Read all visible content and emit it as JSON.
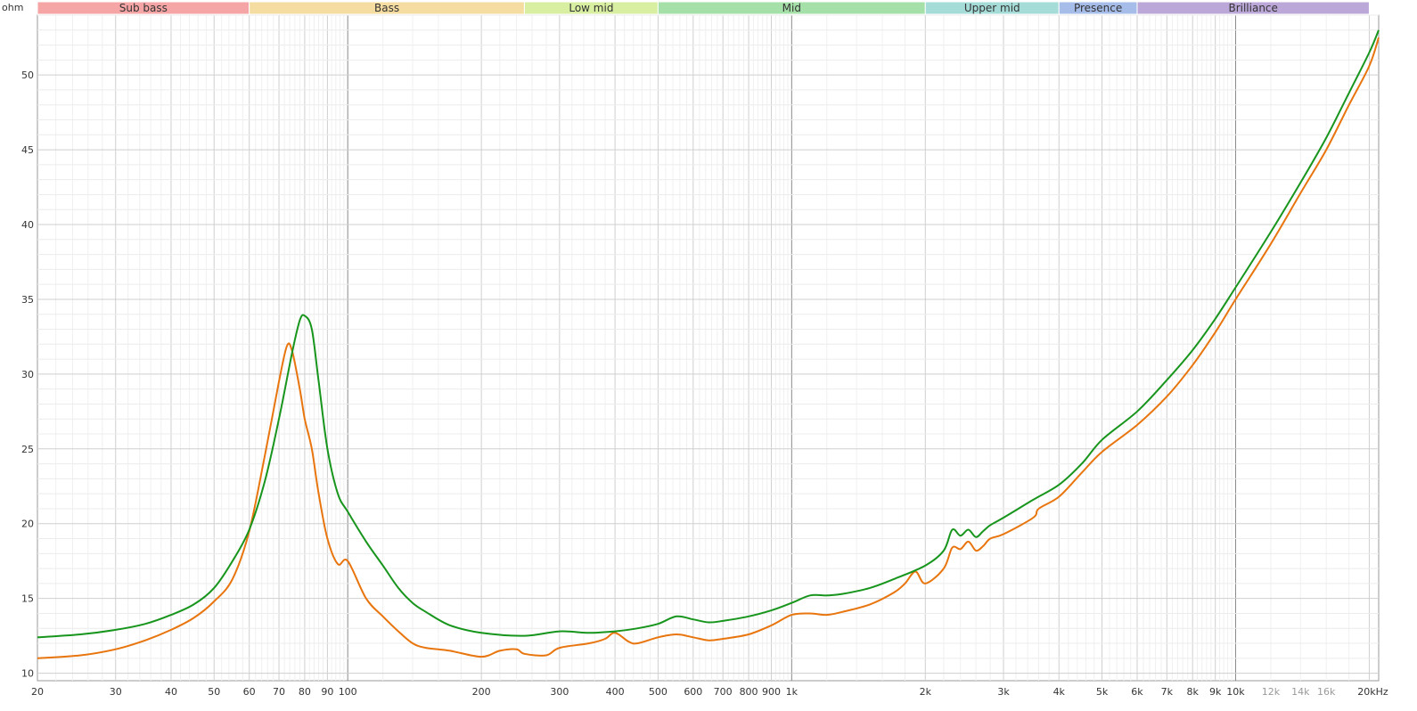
{
  "chart_data": {
    "type": "line",
    "yunit": "ohm",
    "xunit": "kHz",
    "xscale": "log",
    "xlim": [
      20,
      21000
    ],
    "ylim": [
      9.5,
      54
    ],
    "grid": true,
    "bands": [
      {
        "name": "Sub bass",
        "from": 20,
        "to": 60,
        "color": "#f5a5a5"
      },
      {
        "name": "Bass",
        "from": 60,
        "to": 250,
        "color": "#f5dca0"
      },
      {
        "name": "Low mid",
        "from": 250,
        "to": 500,
        "color": "#d8eea0"
      },
      {
        "name": "Mid",
        "from": 500,
        "to": 2000,
        "color": "#a5e0a8"
      },
      {
        "name": "Upper mid",
        "from": 2000,
        "to": 4000,
        "color": "#a5dcd8"
      },
      {
        "name": "Presence",
        "from": 4000,
        "to": 6000,
        "color": "#a5bde8"
      },
      {
        "name": "Brilliance",
        "from": 6000,
        "to": 20000,
        "color": "#bca8d8"
      }
    ],
    "yticks": [
      10,
      15,
      20,
      25,
      30,
      35,
      40,
      45,
      50
    ],
    "xticks": [
      {
        "v": 20,
        "label": "20"
      },
      {
        "v": 30,
        "label": "30"
      },
      {
        "v": 40,
        "label": "40"
      },
      {
        "v": 50,
        "label": "50"
      },
      {
        "v": 60,
        "label": "60"
      },
      {
        "v": 70,
        "label": "70"
      },
      {
        "v": 80,
        "label": "80"
      },
      {
        "v": 90,
        "label": "90"
      },
      {
        "v": 100,
        "label": "100"
      },
      {
        "v": 200,
        "label": "200"
      },
      {
        "v": 300,
        "label": "300"
      },
      {
        "v": 400,
        "label": "400"
      },
      {
        "v": 500,
        "label": "500"
      },
      {
        "v": 600,
        "label": "600"
      },
      {
        "v": 700,
        "label": "700"
      },
      {
        "v": 800,
        "label": "800"
      },
      {
        "v": 900,
        "label": "900"
      },
      {
        "v": 1000,
        "label": "1k"
      },
      {
        "v": 2000,
        "label": "2k"
      },
      {
        "v": 3000,
        "label": "3k"
      },
      {
        "v": 4000,
        "label": "4k"
      },
      {
        "v": 5000,
        "label": "5k"
      },
      {
        "v": 6000,
        "label": "6k"
      },
      {
        "v": 7000,
        "label": "7k"
      },
      {
        "v": 8000,
        "label": "8k"
      },
      {
        "v": 9000,
        "label": "9k"
      },
      {
        "v": 10000,
        "label": "10k"
      },
      {
        "v": 12000,
        "label": "12k",
        "minor": true
      },
      {
        "v": 14000,
        "label": "14k",
        "minor": true
      },
      {
        "v": 16000,
        "label": "16k",
        "minor": true
      },
      {
        "v": 20000,
        "label": "20kHz"
      }
    ],
    "series": [
      {
        "color": "#17951c",
        "x": [
          20,
          25,
          30,
          35,
          40,
          45,
          50,
          55,
          60,
          65,
          70,
          75,
          78,
          80,
          83,
          86,
          90,
          95,
          100,
          110,
          120,
          130,
          140,
          150,
          170,
          200,
          250,
          300,
          350,
          400,
          450,
          500,
          550,
          600,
          650,
          700,
          800,
          900,
          1000,
          1100,
          1200,
          1300,
          1500,
          1700,
          2000,
          2200,
          2300,
          2400,
          2500,
          2600,
          2700,
          2800,
          3000,
          3500,
          4000,
          4500,
          5000,
          6000,
          7000,
          8000,
          9000,
          10000,
          12000,
          14000,
          16000,
          18000,
          20000,
          21000
        ],
        "y": [
          12.4,
          12.6,
          12.9,
          13.3,
          13.9,
          14.6,
          15.7,
          17.5,
          19.6,
          22.8,
          27.0,
          31.5,
          33.6,
          33.9,
          33.0,
          29.5,
          25.0,
          22.0,
          20.8,
          18.8,
          17.2,
          15.7,
          14.7,
          14.1,
          13.2,
          12.7,
          12.5,
          12.8,
          12.7,
          12.8,
          13.0,
          13.3,
          13.8,
          13.6,
          13.4,
          13.5,
          13.8,
          14.2,
          14.7,
          15.2,
          15.2,
          15.3,
          15.7,
          16.3,
          17.2,
          18.2,
          19.6,
          19.2,
          19.6,
          19.1,
          19.5,
          19.9,
          20.4,
          21.6,
          22.6,
          24.0,
          25.6,
          27.5,
          29.6,
          31.6,
          33.7,
          35.8,
          39.5,
          42.8,
          45.8,
          48.8,
          51.5,
          53.0
        ]
      },
      {
        "color": "#e8750e",
        "x": [
          20,
          25,
          30,
          35,
          40,
          45,
          50,
          55,
          60,
          65,
          70,
          73,
          75,
          78,
          80,
          83,
          86,
          90,
          95,
          100,
          110,
          120,
          130,
          140,
          150,
          170,
          200,
          220,
          240,
          250,
          280,
          300,
          350,
          380,
          400,
          430,
          450,
          500,
          550,
          600,
          650,
          700,
          800,
          900,
          1000,
          1100,
          1200,
          1300,
          1500,
          1700,
          1800,
          1900,
          2000,
          2200,
          2300,
          2400,
          2500,
          2600,
          2700,
          2800,
          3000,
          3500,
          3600,
          4000,
          4500,
          5000,
          6000,
          7000,
          8000,
          9000,
          10000,
          12000,
          14000,
          16000,
          18000,
          20000,
          21000
        ],
        "y": [
          11.0,
          11.2,
          11.6,
          12.2,
          12.9,
          13.7,
          14.8,
          16.3,
          19.5,
          24.5,
          29.5,
          31.9,
          31.5,
          29.0,
          27.0,
          25.0,
          22.0,
          19.0,
          17.3,
          17.5,
          15.0,
          13.8,
          12.8,
          12.0,
          11.7,
          11.5,
          11.1,
          11.5,
          11.6,
          11.3,
          11.2,
          11.7,
          12.0,
          12.3,
          12.7,
          12.1,
          12.0,
          12.4,
          12.6,
          12.4,
          12.2,
          12.3,
          12.6,
          13.2,
          13.9,
          14.0,
          13.9,
          14.1,
          14.6,
          15.4,
          16.0,
          16.8,
          16.0,
          17.0,
          18.4,
          18.3,
          18.8,
          18.2,
          18.5,
          19.0,
          19.3,
          20.4,
          21.0,
          21.8,
          23.4,
          24.8,
          26.6,
          28.5,
          30.6,
          32.8,
          35.0,
          38.7,
          42.1,
          45.0,
          48.0,
          50.6,
          52.5
        ]
      }
    ]
  }
}
